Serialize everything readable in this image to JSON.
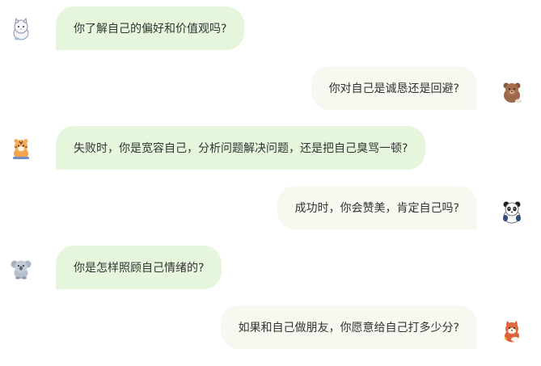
{
  "messages": [
    {
      "side": "left",
      "text": "你了解自己的偏好和价值观吗?",
      "avatar": "white-cat-icon"
    },
    {
      "side": "right",
      "text": "你对自己是诚恳还是回避?",
      "avatar": "brown-bear-icon"
    },
    {
      "side": "left",
      "text": "失败时，你是宽容自己，分析问题解决问题，还是把自己臭骂一顿?",
      "avatar": "tiger-icon"
    },
    {
      "side": "right",
      "text": "成功时，你会赞美，肯定自己吗?",
      "avatar": "panda-icon"
    },
    {
      "side": "left",
      "text": "你是怎样照顾自己情绪的?",
      "avatar": "koala-icon"
    },
    {
      "side": "right",
      "text": "如果和自己做朋友，你愿意给自己打多少分?",
      "avatar": "red-panda-icon"
    }
  ],
  "colors": {
    "left_bubble": "#e6f6dd",
    "right_bubble": "#f5f9f0",
    "text": "#333333"
  }
}
